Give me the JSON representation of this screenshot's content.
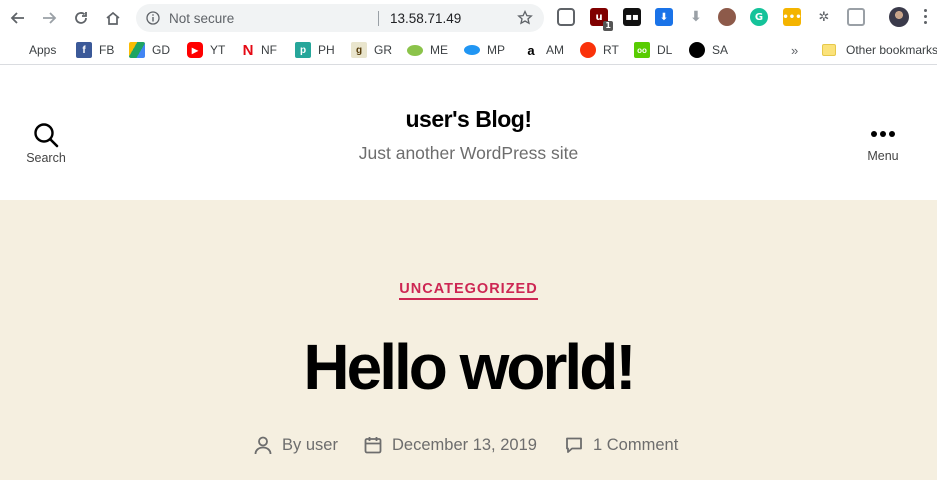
{
  "browser": {
    "address": {
      "security_label": "Not secure",
      "url": "13.58.71.49"
    },
    "colors": {
      "accent_blue": "#1a73e8"
    }
  },
  "bookmarks": {
    "items": [
      {
        "label": "Apps",
        "icon": "apps-grid-icon"
      },
      {
        "label": "FB",
        "icon": "facebook-icon",
        "color": "#3b5998"
      },
      {
        "label": "GD",
        "icon": "google-drive-icon",
        "color": "#1fa463"
      },
      {
        "label": "YT",
        "icon": "youtube-icon",
        "color": "#ff0000"
      },
      {
        "label": "NF",
        "icon": "netflix-icon",
        "color": "#e50914"
      },
      {
        "label": "PH",
        "icon": "ph-icon",
        "color": "#26a69a"
      },
      {
        "label": "GR",
        "icon": "goodreads-icon",
        "color": "#e9e5cd"
      },
      {
        "label": "ME",
        "icon": "me-icon",
        "color": "#8bc34a"
      },
      {
        "label": "MP",
        "icon": "mp-icon",
        "color": "#2196f3"
      },
      {
        "label": "AM",
        "icon": "amazon-icon",
        "color": "#000000"
      },
      {
        "label": "RT",
        "icon": "rotten-tomatoes-icon",
        "color": "#fa320a"
      },
      {
        "label": "DL",
        "icon": "duolingo-icon",
        "color": "#58cc02"
      },
      {
        "label": "SA",
        "icon": "sa-icon",
        "color": "#000000"
      }
    ],
    "more_symbol": "»",
    "other_label": "Other bookmarks"
  },
  "site": {
    "title": "user's Blog!",
    "description": "Just another WordPress site",
    "search_label": "Search",
    "menu_label": "Menu"
  },
  "post": {
    "category": "UNCATEGORIZED",
    "title": "Hello world!",
    "author": "By user",
    "date": "December 13, 2019",
    "comments": "1 Comment",
    "accent_color": "#cd2653",
    "background": "#f5efe0"
  }
}
